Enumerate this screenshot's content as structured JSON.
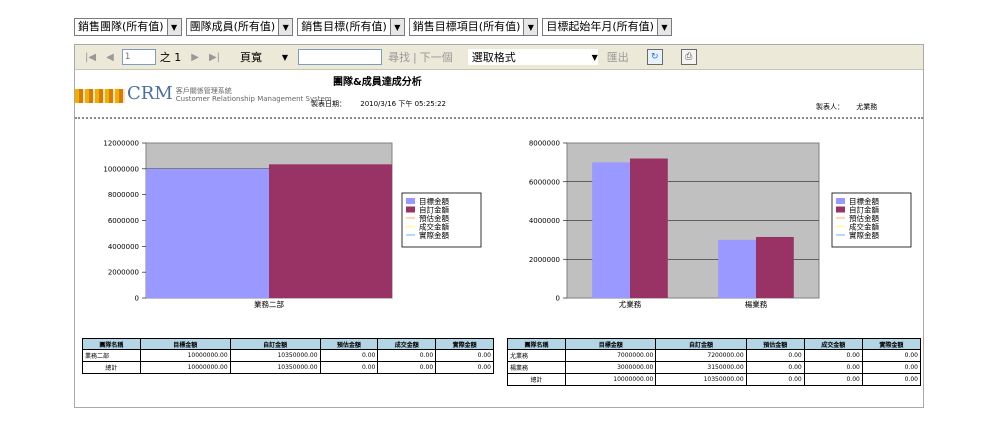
{
  "filters": [
    {
      "label": "銷售團隊(所有值)"
    },
    {
      "label": "團隊成員(所有值)"
    },
    {
      "label": "銷售目標(所有值)"
    },
    {
      "label": "銷售目標項目(所有值)"
    },
    {
      "label": "目標起始年月(所有值)"
    }
  ],
  "toolbar": {
    "page_value": "1",
    "of_text": "之 1",
    "zoom": "頁寬",
    "find_label": "尋找",
    "separator": "|",
    "next_label": "下一個",
    "format_select": "選取格式",
    "export_label": "匯出"
  },
  "report": {
    "title": "團隊&成員達成分析",
    "logo_text": "CRM",
    "logo_sub1": "客戶關係管理系統",
    "logo_sub2": "Customer Relationship Management System",
    "gen_label": "製表日期：",
    "gen_value": "2010/3/16 下午 05:25:22",
    "maker_label": "製表人：",
    "maker_value": "尤業務"
  },
  "colors": {
    "target": "#9999ff",
    "set": "#993366",
    "forecast": "#ffcc99",
    "deal": "#ffff99",
    "actual": "#99ccff",
    "plot_bg": "#c0c0c0",
    "table_header": "#b3d5e6"
  },
  "chart_data": [
    {
      "type": "bar",
      "categories": [
        "業務二部"
      ],
      "series": [
        {
          "name": "目標金額",
          "values": [
            10000000
          ]
        },
        {
          "name": "自訂金額",
          "values": [
            10350000
          ]
        },
        {
          "name": "預估金額",
          "values": [
            0
          ]
        },
        {
          "name": "成交金額",
          "values": [
            0
          ]
        },
        {
          "name": "實際金額",
          "values": [
            0
          ]
        }
      ],
      "y_ticks": [
        "12000000",
        "10000000",
        "8000000",
        "6000000",
        "4000000",
        "2000000",
        "0"
      ],
      "ylim": [
        0,
        12000000
      ],
      "grid": true,
      "legend": "right"
    },
    {
      "type": "bar",
      "categories": [
        "尤業務",
        "楊業務"
      ],
      "series": [
        {
          "name": "目標金額",
          "values": [
            7000000,
            3000000
          ]
        },
        {
          "name": "自訂金額",
          "values": [
            7200000,
            3150000
          ]
        },
        {
          "name": "預估金額",
          "values": [
            0,
            0
          ]
        },
        {
          "name": "成交金額",
          "values": [
            0,
            0
          ]
        },
        {
          "name": "實際金額",
          "values": [
            0,
            0
          ]
        }
      ],
      "y_ticks": [
        "8000000",
        "6000000",
        "4000000",
        "2000000",
        "0"
      ],
      "ylim": [
        0,
        8000000
      ],
      "grid": true,
      "legend": "right"
    }
  ],
  "table_left": {
    "headers": [
      "團隊名稱",
      "目標金額",
      "自訂金額",
      "預估金額",
      "成交金額",
      "實際金額"
    ],
    "rows": [
      [
        "業務二部",
        "10000000.00",
        "10350000.00",
        "0.00",
        "0.00",
        "0.00"
      ],
      [
        "總計",
        "10000000.00",
        "10350000.00",
        "0.00",
        "0.00",
        "0.00"
      ]
    ]
  },
  "table_right": {
    "headers": [
      "團隊名稱",
      "目標金額",
      "自訂金額",
      "預估金額",
      "成交金額",
      "實際金額"
    ],
    "rows": [
      [
        "尤業務",
        "7000000.00",
        "7200000.00",
        "0.00",
        "0.00",
        "0.00"
      ],
      [
        "楊業務",
        "3000000.00",
        "3150000.00",
        "0.00",
        "0.00",
        "0.00"
      ],
      [
        "總計",
        "10000000.00",
        "10350000.00",
        "0.00",
        "0.00",
        "0.00"
      ]
    ]
  }
}
